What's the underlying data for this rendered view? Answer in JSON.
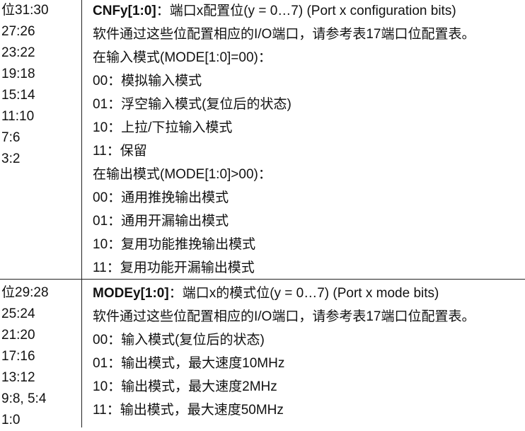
{
  "cnf": {
    "bits": [
      "位31:30",
      "27:26",
      "23:22",
      "19:18",
      "15:14",
      "11:10",
      "7:6",
      "3:2"
    ],
    "field_name": "CNFy[1:0]",
    "field_desc": "：端口x配置位(y = 0…7) (Port x configuration bits)",
    "lines": [
      "软件通过这些位配置相应的I/O端口，请参考表17端口位配置表。",
      "在输入模式(MODE[1:0]=00)：",
      "00：模拟输入模式",
      "01：浮空输入模式(复位后的状态)",
      "10：上拉/下拉输入模式",
      "11：保留",
      "在输出模式(MODE[1:0]>00)：",
      "00：通用推挽输出模式",
      "01：通用开漏输出模式",
      "10：复用功能推挽输出模式",
      "11：复用功能开漏输出模式"
    ]
  },
  "mode": {
    "bits": [
      "位29:28",
      "25:24",
      "21:20",
      "17:16",
      "13:12",
      "9:8, 5:4",
      "1:0"
    ],
    "field_name": "MODEy[1:0]",
    "field_desc": "：端口x的模式位(y = 0…7) (Port x mode bits)",
    "lines": [
      "软件通过这些位配置相应的I/O端口，请参考表17端口位配置表。",
      "00：输入模式(复位后的状态)",
      "01：输出模式，最大速度10MHz",
      "10：输出模式，最大速度2MHz",
      "11：输出模式，最大速度50MHz"
    ]
  }
}
